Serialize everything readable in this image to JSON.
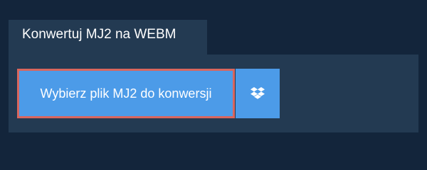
{
  "tab": {
    "title": "Konwertuj MJ2 na WEBM"
  },
  "upload": {
    "button_label": "Wybierz plik MJ2 do konwersji"
  },
  "dropbox": {
    "icon": "dropbox-icon"
  },
  "colors": {
    "background": "#13253b",
    "panel": "#233a52",
    "button": "#4c9be8",
    "highlight_border": "#d9665e"
  }
}
